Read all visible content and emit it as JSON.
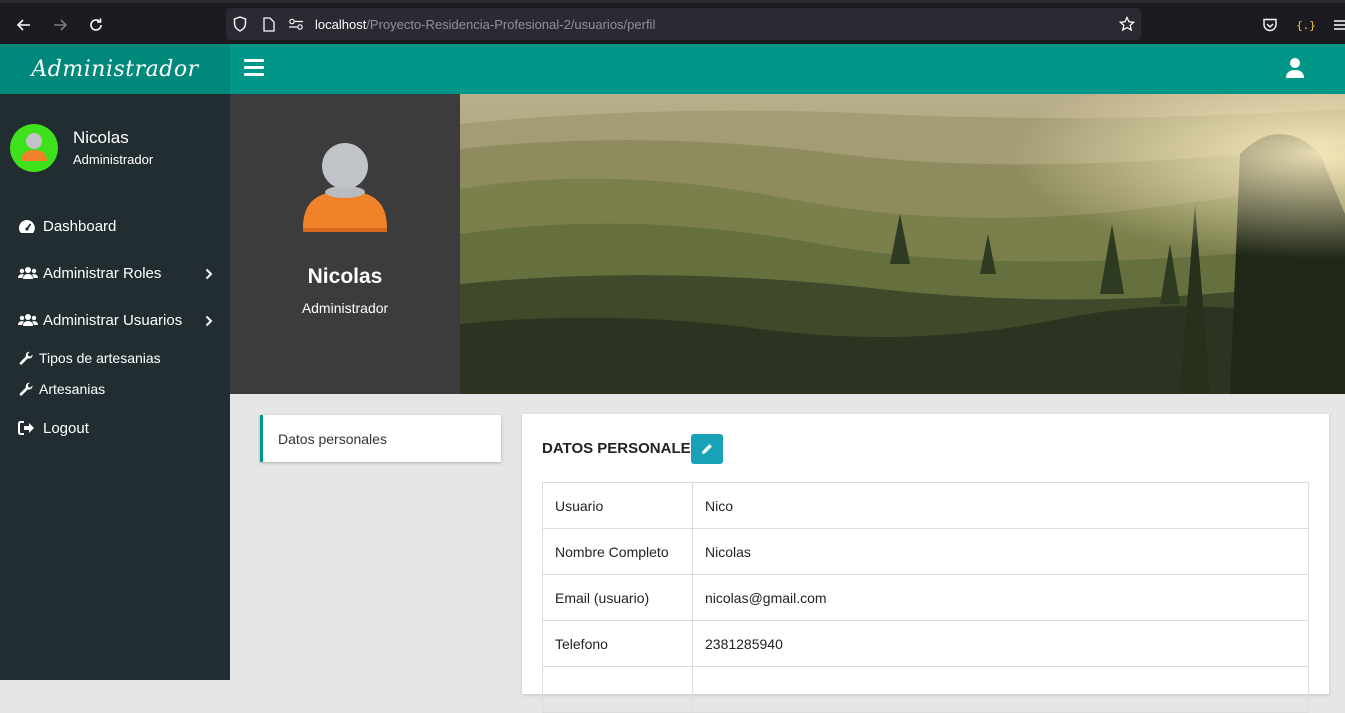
{
  "browser": {
    "url_host": "localhost",
    "url_path": "/Proyecto-Residencia-Profesional-2/usuarios/perfil"
  },
  "header": {
    "brand": "Administrador"
  },
  "sidebar": {
    "user_name": "Nicolas",
    "user_role": "Administrador",
    "items": [
      {
        "label": "Dashboard",
        "icon": "dashboard-icon"
      },
      {
        "label": "Administrar Roles",
        "icon": "users-icon"
      },
      {
        "label": "Administrar Usuarios",
        "icon": "users-icon"
      },
      {
        "label": "Tipos de artesanias",
        "icon": "wrench-icon"
      },
      {
        "label": "Artesanias",
        "icon": "wrench-icon"
      },
      {
        "label": "Logout",
        "icon": "logout-icon"
      }
    ]
  },
  "profile": {
    "name": "Nicolas",
    "role": "Administrador"
  },
  "tabs": {
    "personal": "Datos personales"
  },
  "panel": {
    "title": "DATOS PERSONALES",
    "rows": [
      {
        "key": "Usuario",
        "value": "Nico"
      },
      {
        "key": "Nombre Completo",
        "value": "Nicolas"
      },
      {
        "key": "Email (usuario)",
        "value": "nicolas@gmail.com"
      },
      {
        "key": "Telefono",
        "value": "2381285940"
      },
      {
        "key": "",
        "value": ""
      }
    ]
  },
  "colors": {
    "accent": "#009688",
    "brand": "#00897b",
    "sidebar": "#222d32",
    "edit_button": "#17a2b8",
    "avatar_bg": "#3ee11a"
  }
}
